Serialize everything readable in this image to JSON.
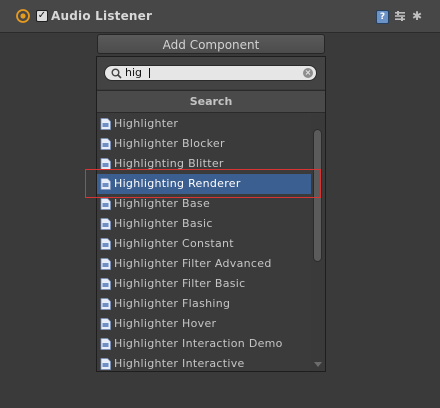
{
  "component": {
    "title": "Audio Listener",
    "enabled": true,
    "icon": "audio-listener-icon",
    "help_label": "?",
    "gear_label": "✱"
  },
  "add_component": {
    "label": "Add Component"
  },
  "search": {
    "value": "hig",
    "placeholder": ""
  },
  "list": {
    "header": "Search",
    "items": [
      {
        "label": "Highlighter"
      },
      {
        "label": "Highlighter Blocker"
      },
      {
        "label": "Highlighting Blitter"
      },
      {
        "label": "Highlighting Renderer",
        "selected": true
      },
      {
        "label": "Highlighter Base"
      },
      {
        "label": "Highlighter Basic"
      },
      {
        "label": "Highlighter Constant"
      },
      {
        "label": "Highlighter Filter Advanced"
      },
      {
        "label": "Highlighter Filter Basic"
      },
      {
        "label": "Highlighter Flashing"
      },
      {
        "label": "Highlighter Hover"
      },
      {
        "label": "Highlighter Interaction Demo"
      },
      {
        "label": "Highlighter Interactive"
      }
    ]
  },
  "colors": {
    "selection": "#3c5f91",
    "annotation": "#d83434"
  }
}
